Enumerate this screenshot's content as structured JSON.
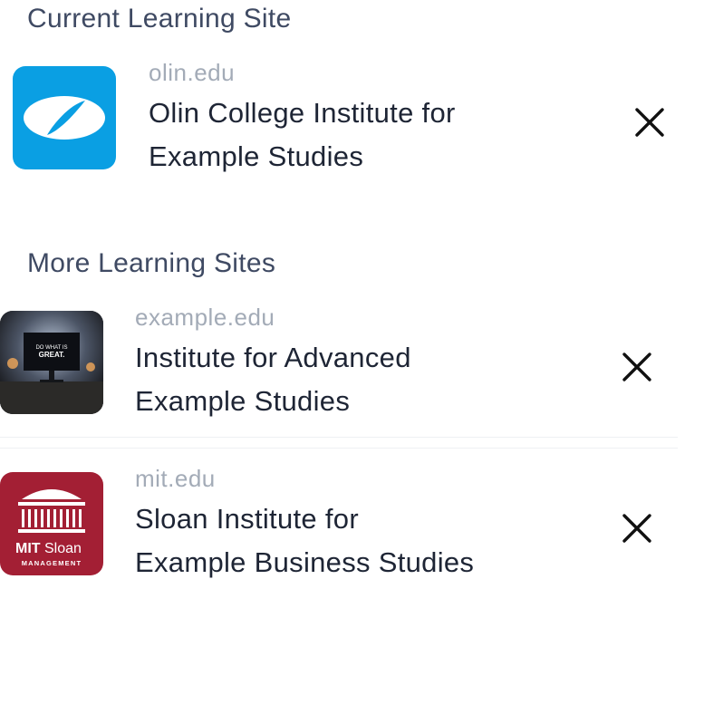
{
  "current": {
    "title": "Current Learning Site",
    "site": {
      "domain": "olin.edu",
      "name": "Olin College Institute for\nExample Studies",
      "logo": "olin-logo",
      "color": "#0a9fe3"
    }
  },
  "more": {
    "title": "More Learning Sites",
    "sites": [
      {
        "domain": "example.edu",
        "name": "Institute for Advanced\nExample Studies",
        "logo": "monitor-photo",
        "logo_text": [
          "DO WHAT IS",
          "GREAT."
        ]
      },
      {
        "domain": "mit.edu",
        "name": "Sloan Institute for\nExample Business Studies",
        "logo": "mit-sloan-logo",
        "logo_text": [
          "MIT",
          "Sloan",
          "MANAGEMENT"
        ],
        "color": "#a31f34"
      }
    ]
  },
  "icons": {
    "remove": "close-icon"
  }
}
